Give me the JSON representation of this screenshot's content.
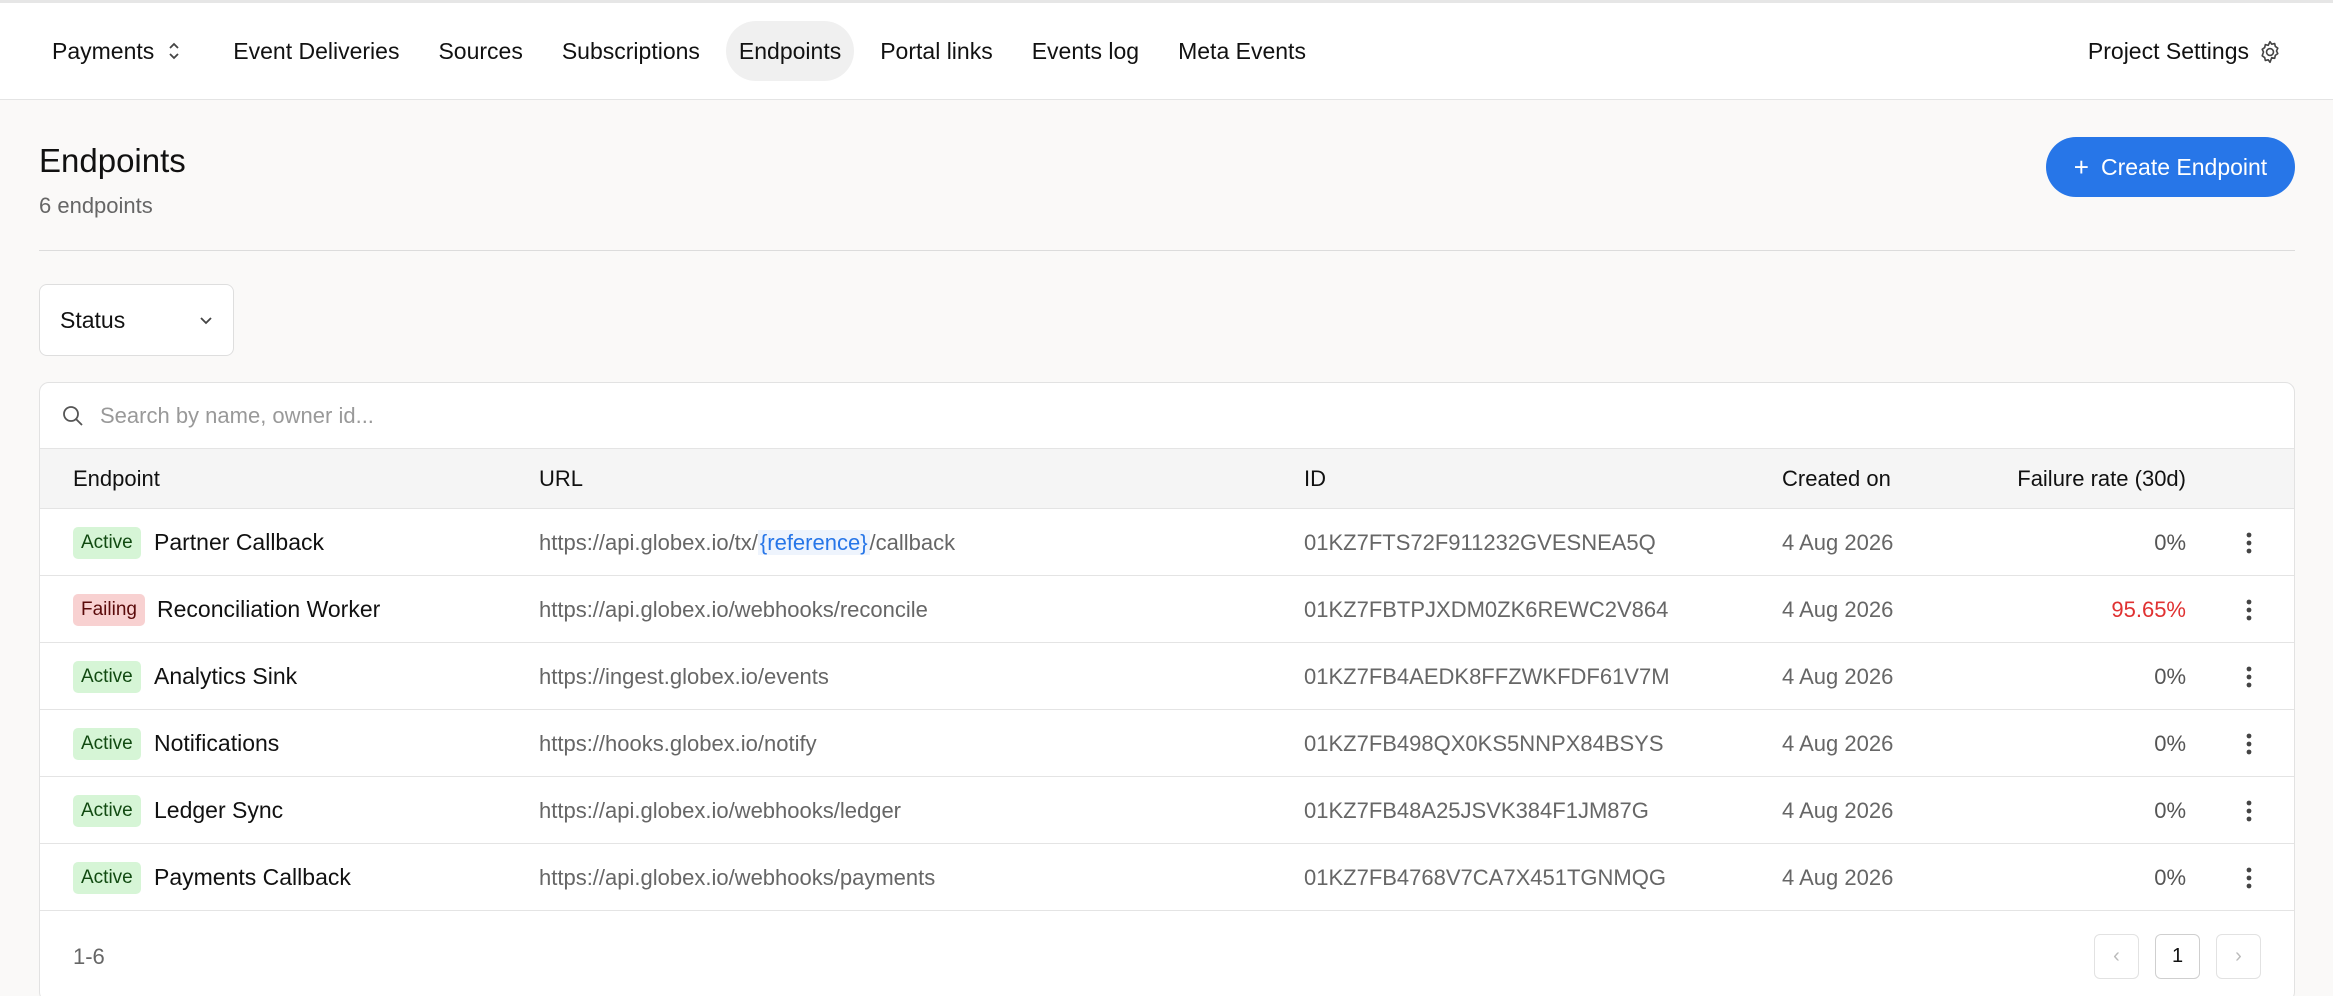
{
  "nav": {
    "project": "Payments",
    "items": [
      {
        "label": "Event Deliveries",
        "active": false
      },
      {
        "label": "Sources",
        "active": false
      },
      {
        "label": "Subscriptions",
        "active": false
      },
      {
        "label": "Endpoints",
        "active": true
      },
      {
        "label": "Portal links",
        "active": false
      },
      {
        "label": "Events log",
        "active": false
      },
      {
        "label": "Meta Events",
        "active": false
      }
    ],
    "settings_label": "Project Settings"
  },
  "header": {
    "title": "Endpoints",
    "subtitle": "6 endpoints",
    "create_label": "Create Endpoint",
    "create_icon": "+"
  },
  "filter": {
    "status_label": "Status"
  },
  "search": {
    "placeholder": "Search by name, owner id..."
  },
  "table": {
    "columns": [
      "Endpoint",
      "URL",
      "ID",
      "Created on",
      "Failure rate (30d)"
    ],
    "rows": [
      {
        "status": "Active",
        "name": "Partner Callback",
        "url_pre": "https://api.globex.io/tx/",
        "url_ref": "{reference}",
        "url_post": "/callback",
        "id": "01KZ7FTS72F911232GVESNEA5Q",
        "created": "4 Aug 2026",
        "rate": "0%"
      },
      {
        "status": "Failing",
        "name": "Reconciliation Worker",
        "url_pre": "https://api.globex.io/webhooks/reconcile",
        "url_ref": "",
        "url_post": "",
        "id": "01KZ7FBTPJXDM0ZK6REWC2V864",
        "created": "4 Aug 2026",
        "rate": "95.65%"
      },
      {
        "status": "Active",
        "name": "Analytics Sink",
        "url_pre": "https://ingest.globex.io/events",
        "url_ref": "",
        "url_post": "",
        "id": "01KZ7FB4AEDK8FFZWKFDF61V7M",
        "created": "4 Aug 2026",
        "rate": "0%"
      },
      {
        "status": "Active",
        "name": "Notifications",
        "url_pre": "https://hooks.globex.io/notify",
        "url_ref": "",
        "url_post": "",
        "id": "01KZ7FB498QX0KS5NNPX84BSYS",
        "created": "4 Aug 2026",
        "rate": "0%"
      },
      {
        "status": "Active",
        "name": "Ledger Sync",
        "url_pre": "https://api.globex.io/webhooks/ledger",
        "url_ref": "",
        "url_post": "",
        "id": "01KZ7FB48A25JSVK384F1JM87G",
        "created": "4 Aug 2026",
        "rate": "0%"
      },
      {
        "status": "Active",
        "name": "Payments Callback",
        "url_pre": "https://api.globex.io/webhooks/payments",
        "url_ref": "",
        "url_post": "",
        "id": "01KZ7FB4768V7CA7X451TGNMQG",
        "created": "4 Aug 2026",
        "rate": "0%"
      }
    ]
  },
  "pagination": {
    "range": "1-6",
    "page": "1",
    "prev": "‹",
    "next": "›"
  },
  "colors": {
    "accent": "#2776e8",
    "active_badge": "#d6f5d6",
    "failing_badge": "#f8d1d1",
    "failure_text": "#e03131"
  }
}
